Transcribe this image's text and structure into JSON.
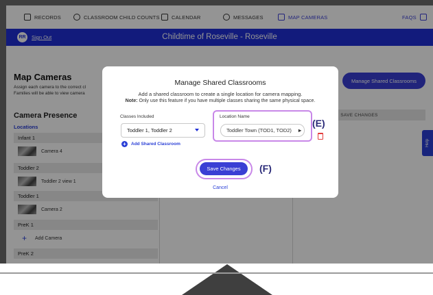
{
  "nav": {
    "items": [
      {
        "label": "RECORDS",
        "icon": "id-card-icon"
      },
      {
        "label": "CLASSROOM CHILD COUNTS",
        "icon": "check-circle-icon"
      },
      {
        "label": "CALENDAR",
        "icon": "calendar-icon"
      },
      {
        "label": "MESSAGES",
        "icon": "message-icon"
      },
      {
        "label": "MAP CAMERAS",
        "icon": "camera-icon",
        "active": true
      }
    ],
    "faqs": "FAQS"
  },
  "banner": {
    "avatar_initials": "RR",
    "sign_out": "Sign Out",
    "title": "Childtime of Roseville - Roseville"
  },
  "page": {
    "title": "Map Cameras",
    "desc_line1": "Assign each camera to the correct cl",
    "desc_line2": "Families will be able to view camera",
    "manage_button": "Manage Shared Classrooms",
    "camera_presence": "Camera Presence",
    "locations_label": "Locations",
    "save_changes_col": "SAVE CHANGES",
    "help": "Help",
    "groups": [
      {
        "name": "Infant 1",
        "row": {
          "type": "camera",
          "label": "Camera 4"
        }
      },
      {
        "name": "Toddler 2",
        "row": {
          "type": "camera",
          "label": "Toddler 2 view 1"
        }
      },
      {
        "name": "Toddler 1",
        "row": {
          "type": "camera",
          "label": "Camera 2"
        }
      },
      {
        "name": "PreK 1",
        "row": {
          "type": "add",
          "label": "Add Camera"
        }
      },
      {
        "name": "PreK 2",
        "row": null
      }
    ]
  },
  "modal": {
    "title": "Manage Shared Classrooms",
    "line1": "Add a shared classroom to create a single location for camera mapping.",
    "note_bold": "Note:",
    "note_text": " Only use this feature if you have multiple classes sharing the same physical space.",
    "classes_label": "Classes Included",
    "classes_value": "Toddler 1, Toddler 2",
    "location_label": "Location Name",
    "location_value": "Toddler Town (TOD1, TOD2)",
    "add_shared": "Add Shared Classroom",
    "save_button": "Save Changes",
    "cancel": "Cancel",
    "callout_e": "(E)",
    "callout_f": "(F)"
  },
  "colors": {
    "primary": "#3a3fd4",
    "banner": "#1f2fd6",
    "highlight": "#c887e8",
    "callout": "#2a2a78"
  }
}
